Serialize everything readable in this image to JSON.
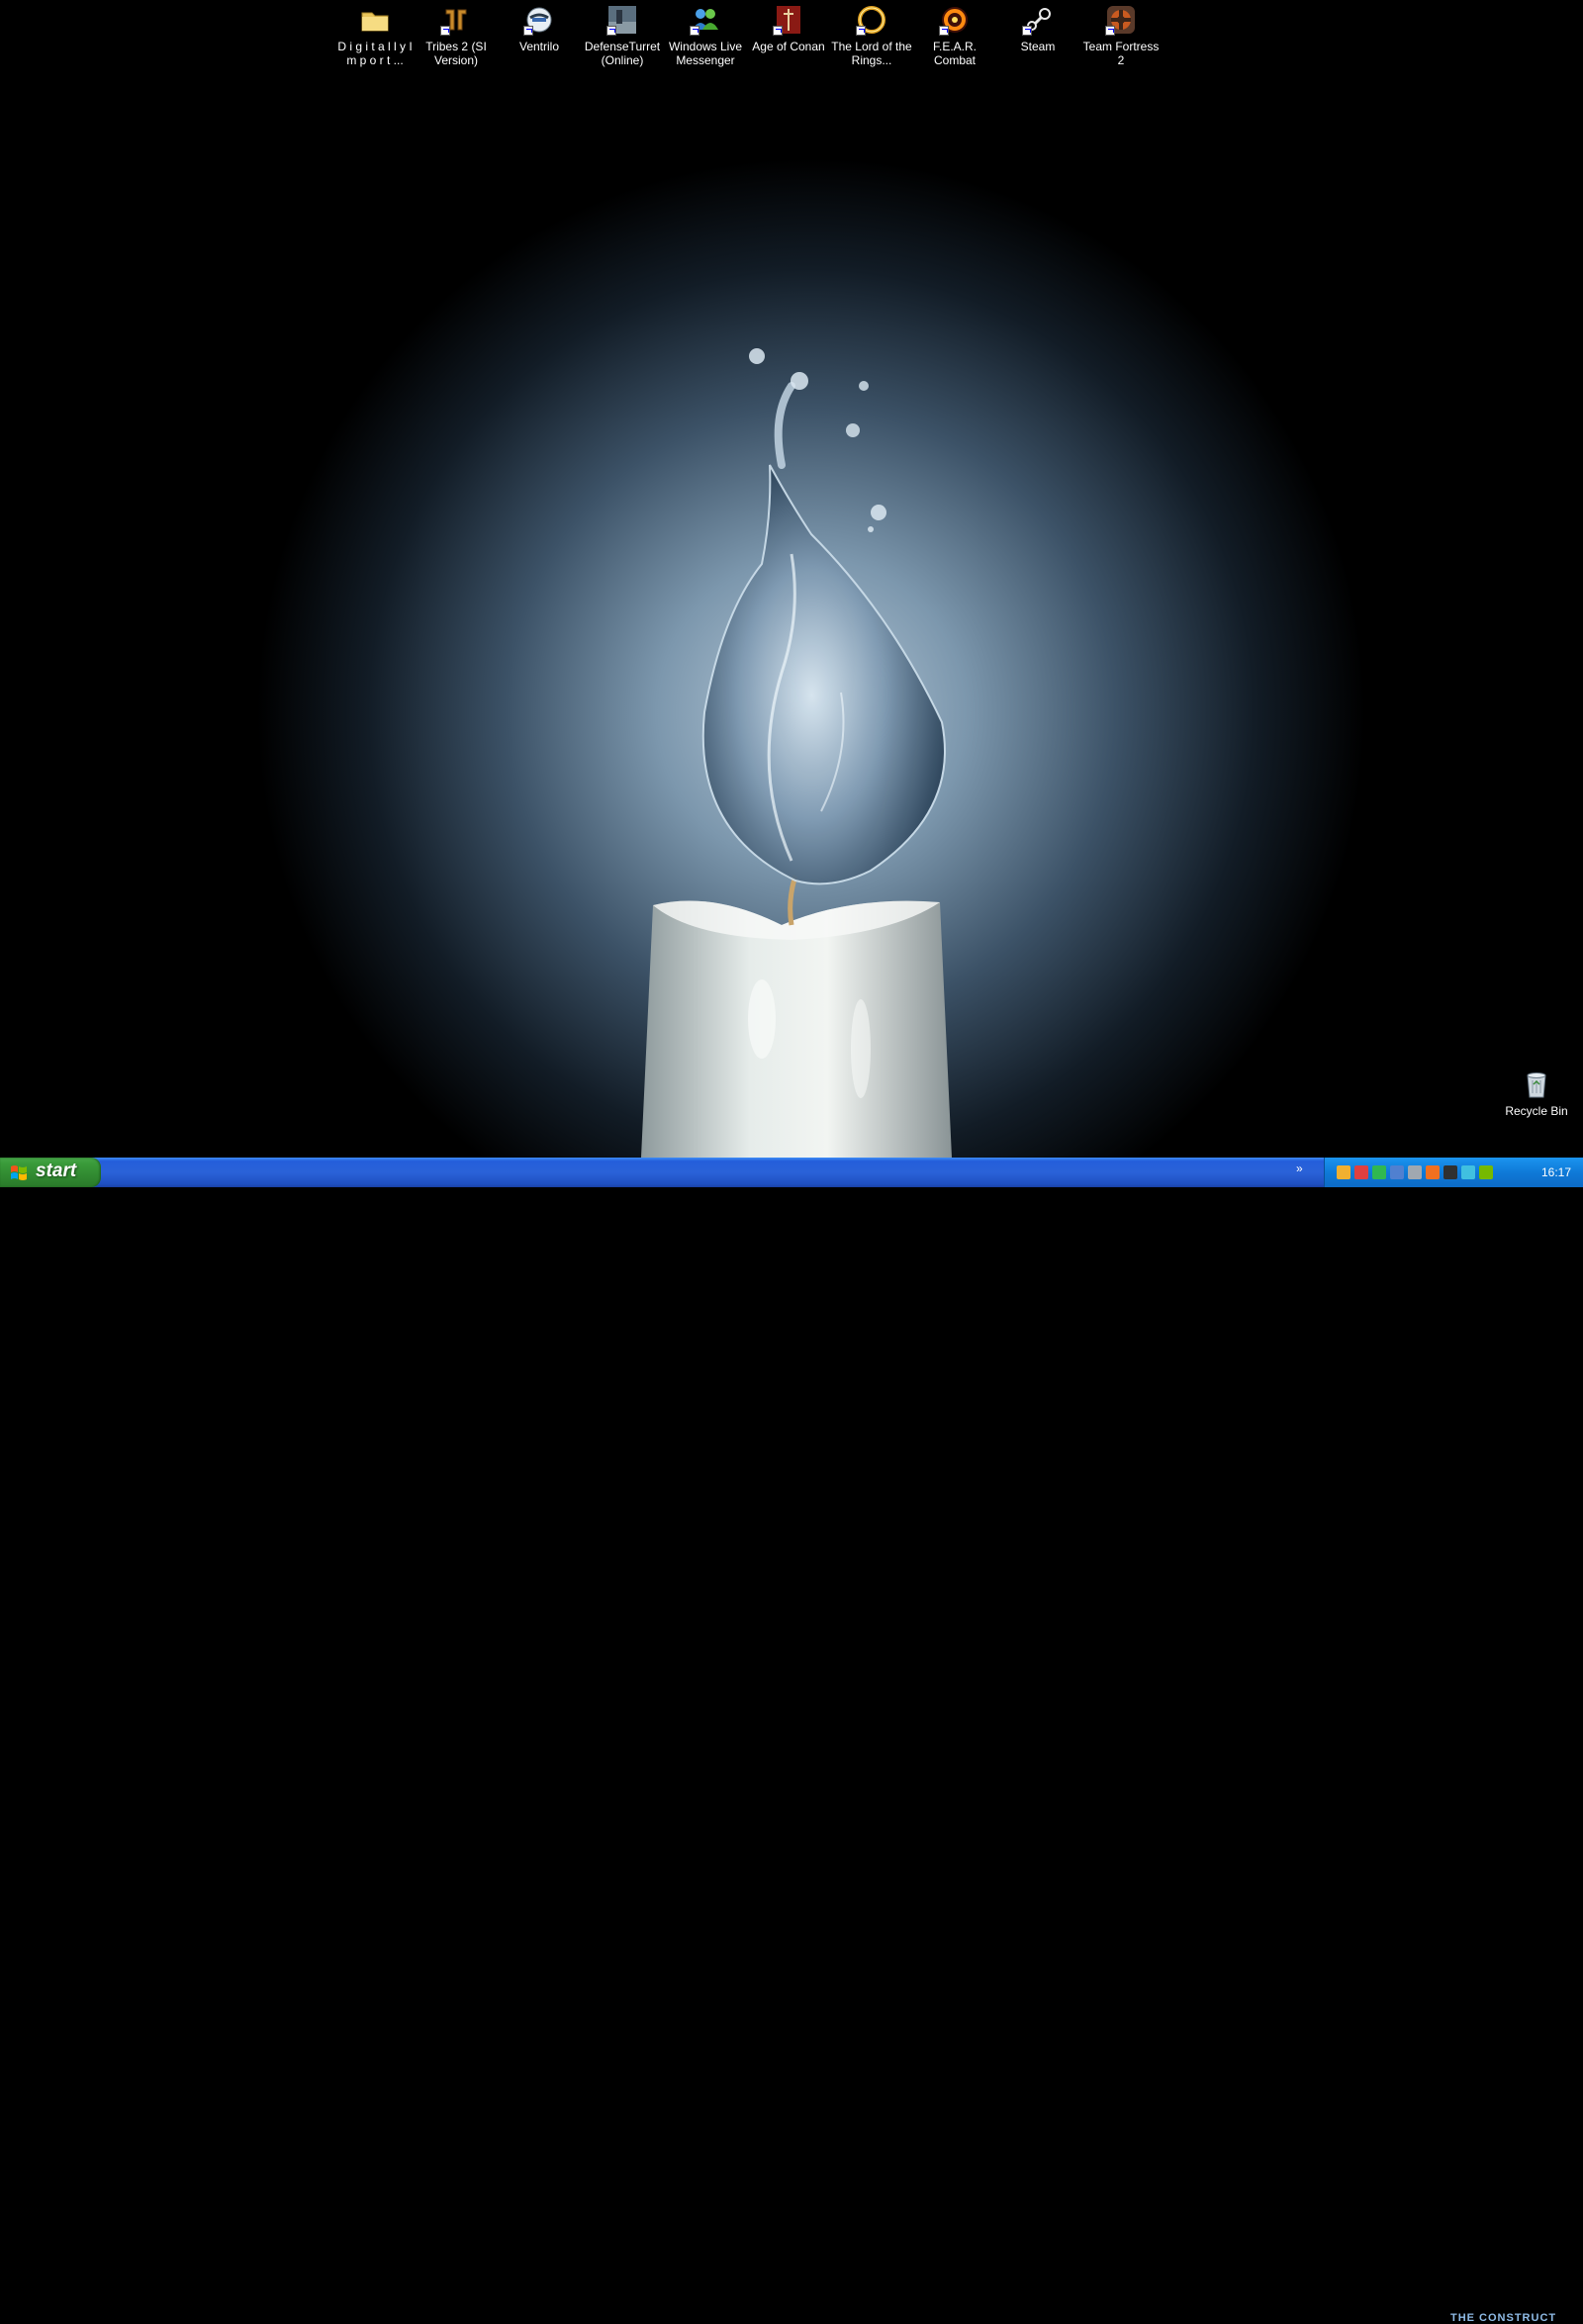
{
  "desktop": {
    "icons": [
      {
        "label": "D i g i t a l l y  I m p o r t ...",
        "icon": "folder-icon",
        "shortcut": false
      },
      {
        "label": "Tribes 2 (SI Version)",
        "icon": "tribes2-icon",
        "shortcut": true
      },
      {
        "label": "Ventrilo",
        "icon": "ventrilo-icon",
        "shortcut": true
      },
      {
        "label": "DefenseTurret (Online)",
        "icon": "defenseturret-icon",
        "shortcut": true
      },
      {
        "label": "Windows Live Messenger",
        "icon": "messenger-icon",
        "shortcut": true
      },
      {
        "label": "Age of Conan",
        "icon": "age-of-conan-icon",
        "shortcut": true
      },
      {
        "label": "The Lord of the Rings...",
        "icon": "lotro-icon",
        "shortcut": true
      },
      {
        "label": "F.E.A.R. Combat",
        "icon": "fear-combat-icon",
        "shortcut": true
      },
      {
        "label": "Steam",
        "icon": "steam-icon",
        "shortcut": true
      },
      {
        "label": "Team Fortress 2",
        "icon": "tf2-icon",
        "shortcut": true
      }
    ],
    "recycle_bin": {
      "label": "Recycle Bin",
      "icon": "recycle-bin-icon"
    }
  },
  "taskbar": {
    "start_label": "start",
    "tray_expand": "»",
    "watermark": "THE CONSTRUCT",
    "clock": "16:17"
  },
  "colors": {
    "taskbar_blue": "#245edb",
    "start_green": "#3a9b3a",
    "tray_blue": "#0f7ad8"
  }
}
